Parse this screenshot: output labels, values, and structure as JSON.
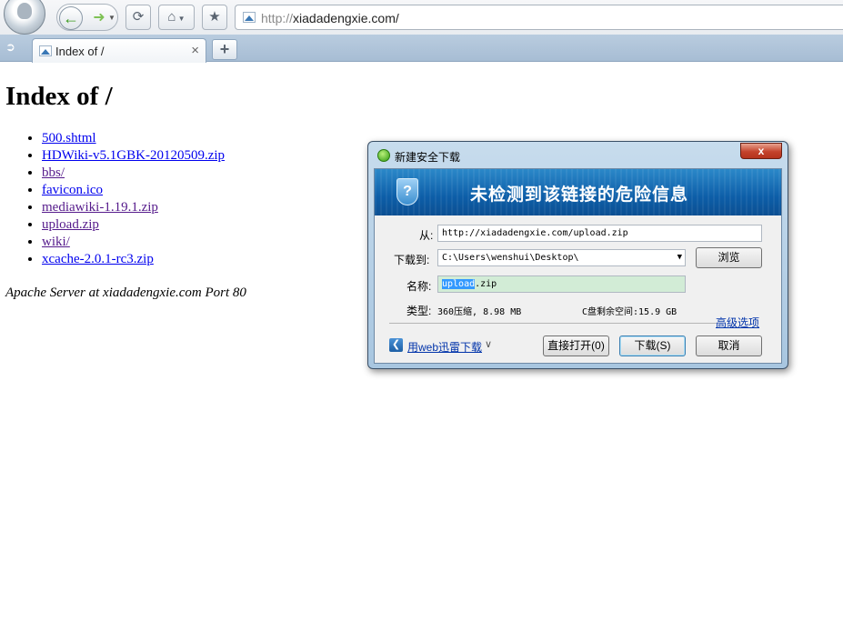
{
  "browser": {
    "url_protocol": "http://",
    "url_host": "xiadadengxie.com/",
    "tab_title": "Index of /",
    "new_tab_label": "+",
    "tab_close": "×"
  },
  "page": {
    "heading": "Index of /",
    "links": [
      {
        "text": "500.shtml",
        "visited": false
      },
      {
        "text": "HDWiki-v5.1GBK-20120509.zip",
        "visited": false
      },
      {
        "text": "bbs/",
        "visited": true
      },
      {
        "text": "favicon.ico",
        "visited": false
      },
      {
        "text": "mediawiki-1.19.1.zip",
        "visited": true
      },
      {
        "text": "upload.zip",
        "visited": true
      },
      {
        "text": "wiki/",
        "visited": true
      },
      {
        "text": "xcache-2.0.1-rc3.zip",
        "visited": false
      }
    ],
    "footer": "Apache Server at xiadadengxie.com Port 80"
  },
  "dialog": {
    "title": "新建安全下载",
    "close_label": "x",
    "banner": "未检测到该链接的危险信息",
    "from_label": "从:",
    "from_value": "http://xiadadengxie.com/upload.zip",
    "save_to_label": "下载到:",
    "save_to_value": "C:\\Users\\wenshui\\Desktop\\",
    "browse_button": "浏览",
    "name_label": "名称:",
    "name_selected": "upload",
    "name_rest": ".zip",
    "type_label": "类型:",
    "type_value": "360压缩, 8.98 MB",
    "free_space": "C盘剩余空间:15.9 GB",
    "advanced_link": "高级选项",
    "web_download_link": "用web迅雷下载",
    "open_button": "直接打开(0)",
    "download_button": "下载(S)",
    "cancel_button": "取消"
  }
}
